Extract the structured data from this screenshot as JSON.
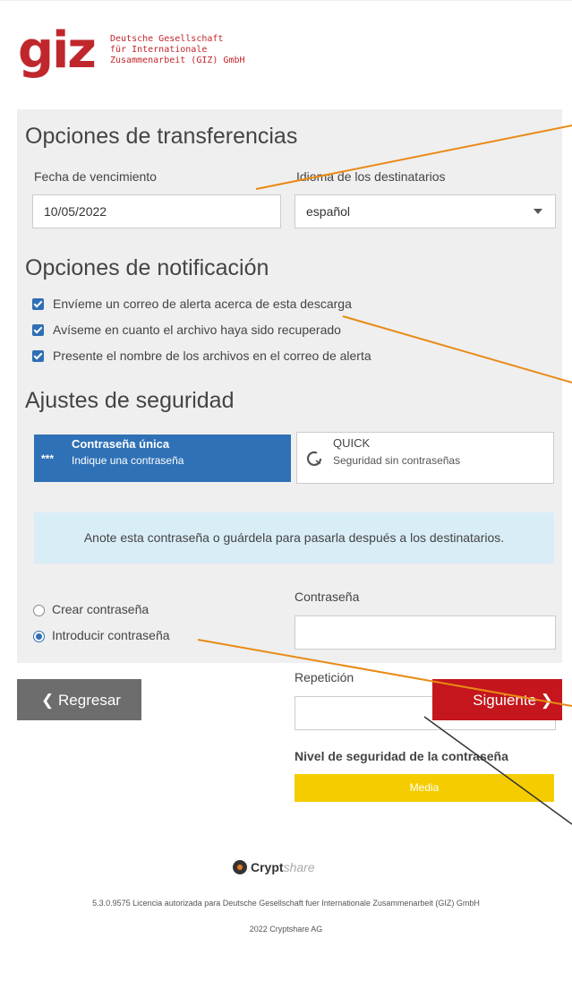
{
  "brand": {
    "logo_mark": "giz",
    "logo_line1": "Deutsche Gesellschaft",
    "logo_line2": "für Internationale",
    "logo_line3": "Zusammenarbeit (GIZ) GmbH",
    "color": "#c0272d"
  },
  "transfer_options": {
    "heading": "Opciones de transferencias",
    "expiry_label": "Fecha de vencimiento",
    "expiry_value": "10/05/2022",
    "language_label": "Idioma de los destinatarios",
    "language_value": "español"
  },
  "notification_options": {
    "heading": "Opciones de notificación",
    "items": [
      {
        "label": "Envíeme un correo de alerta acerca de esta descarga",
        "checked": true
      },
      {
        "label": "Avíseme en cuanto el archivo haya sido recuperado",
        "checked": true
      },
      {
        "label": "Presente el nombre de los archivos en el correo de alerta",
        "checked": true
      }
    ]
  },
  "security": {
    "heading": "Ajustes de seguridad",
    "tab_password_stars": "***",
    "tab_password_title": "Contraseña única",
    "tab_password_sub": "Indique una contraseña",
    "tab_quick_title": "QUICK",
    "tab_quick_sub": "Seguridad sin contraseñas",
    "info_text": "Anote esta contraseña o guárdela para pasarla después a los destinatarios.",
    "radio_create": "Crear contraseña",
    "radio_enter": "Introducir contraseña",
    "selected": "enter",
    "password_label": "Contraseña",
    "password_value": "",
    "repeat_label": "Repetición",
    "repeat_value": "",
    "strength_label": "Nivel de seguridad de la contraseña",
    "strength_value": "Media",
    "accent": "#2f71b6",
    "meter_color": "#f5cc00"
  },
  "nav": {
    "back_label": "❮ Regresar",
    "next_label": "Siguiente ❯",
    "next_color": "#c4161c"
  },
  "footer": {
    "logo_word": "Crypt",
    "logo_word2": "share",
    "license": "5.3.0.9575 Licencia autorizada para Deutsche Gesellschaft fuer Internationale Zusammenarbeit (GIZ) GmbH",
    "copyright": "2022 Cryptshare AG"
  }
}
